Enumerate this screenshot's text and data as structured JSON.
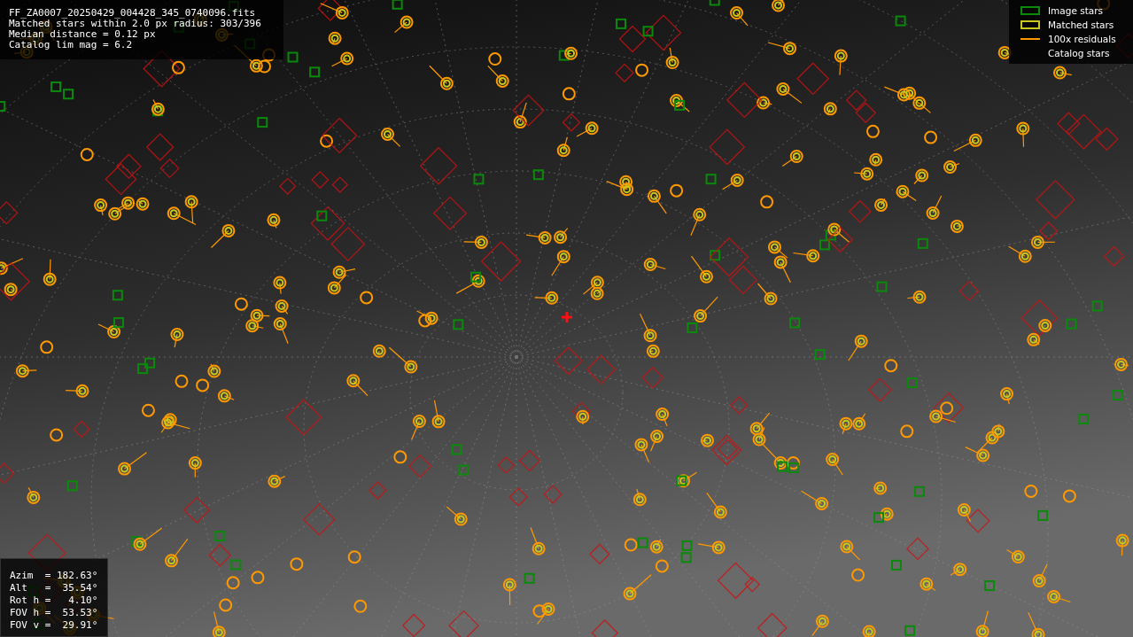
{
  "info": [
    "FF_ZA0007_20250429_004428_345_0740096.fits",
    "Matched stars within 2.0 px radius: 303/396",
    "Median distance = 0.12 px",
    "Catalog lim mag = 6.2"
  ],
  "legend": [
    {
      "kind": "green-box",
      "label": "Image stars"
    },
    {
      "kind": "yellow-box",
      "label": "Matched stars"
    },
    {
      "kind": "line",
      "label": "100x residuals"
    },
    {
      "kind": "blank",
      "label": "Catalog stars"
    }
  ],
  "pointing": [
    "Azim  = 182.63°",
    "Alt   =  35.54°",
    "Rot h =   4.10°",
    "FOV h =  53.53°",
    "FOV v =  29.91°"
  ]
}
